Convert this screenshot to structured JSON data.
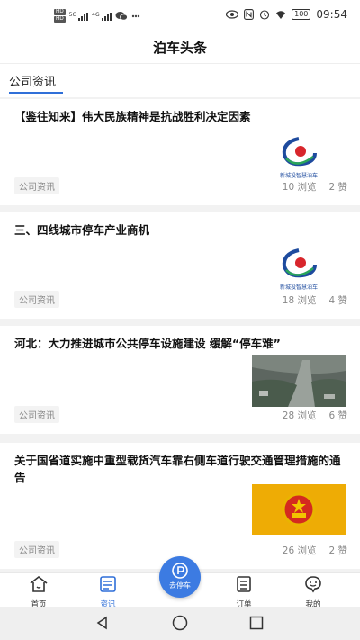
{
  "statusbar": {
    "hd_top": "HD",
    "hd_bottom": "HD",
    "net1": "5G",
    "net2": "4G",
    "battery": "100",
    "time": "09:54"
  },
  "app": {
    "title": "泊车头条"
  },
  "tabs": {
    "active": "公司资讯"
  },
  "articles": [
    {
      "title": "【鉴往知来】伟大民族精神是抗战胜利决定因素",
      "tag": "公司资讯",
      "views": "10 浏览",
      "likes": "2 赞",
      "thumb_caption": "新城投智慧泊车"
    },
    {
      "title": "三、四线城市停车产业商机",
      "tag": "公司资讯",
      "views": "18 浏览",
      "likes": "4 赞",
      "thumb_caption": "新城投智慧泊车"
    },
    {
      "title": "河北：大力推进城市公共停车设施建设 缓解“停车难”",
      "tag": "公司资讯",
      "views": "28 浏览",
      "likes": "6 赞"
    },
    {
      "title": "关于国省道实施中重型载货汽车靠右侧车道行驶交通管理措施的通告",
      "tag": "公司资讯",
      "views": "26 浏览",
      "likes": "2 赞"
    }
  ],
  "bottom_nav": {
    "home": "首页",
    "news": "资讯",
    "park": "去停车",
    "orders": "订单",
    "mine": "我的"
  },
  "colors": {
    "accent": "#2f6fd8",
    "fab": "#3c7be2"
  }
}
